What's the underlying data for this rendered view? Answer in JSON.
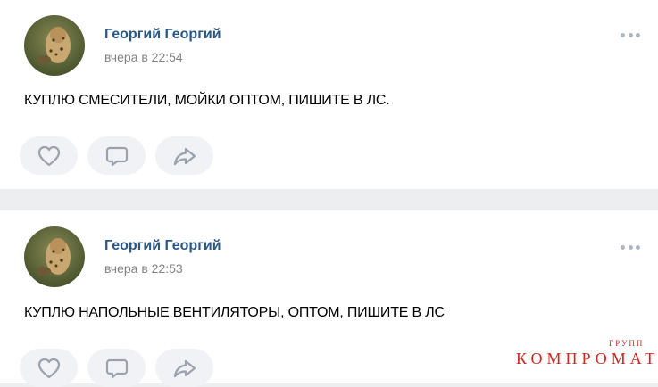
{
  "posts": [
    {
      "author": "Георгий Георгий",
      "time": "вчера в 22:54",
      "text": "КУПЛЮ СМЕСИТЕЛИ, МОЙКИ ОПТОМ, ПИШИТЕ В ЛС.",
      "avatar_icon": "leopard-photo",
      "actions": [
        "like-icon",
        "comment-icon",
        "share-icon"
      ]
    },
    {
      "author": "Георгий Георгий",
      "time": "вчера в 22:53",
      "text": "КУПЛЮ НАПОЛЬНЫЕ ВЕНТИЛЯТОРЫ, ОПТОМ, ПИШИТЕ В ЛС",
      "avatar_icon": "leopard-photo",
      "actions": [
        "like-icon",
        "comment-icon",
        "share-icon"
      ]
    }
  ],
  "watermark": {
    "main": "КОМПРОМАТ",
    "small": "ГРУПП"
  },
  "colors": {
    "author": "#2a5885",
    "time": "#828282",
    "action_bg": "#f0f2f5",
    "icon": "#99a2ad",
    "watermark": "#cc2a1e"
  }
}
